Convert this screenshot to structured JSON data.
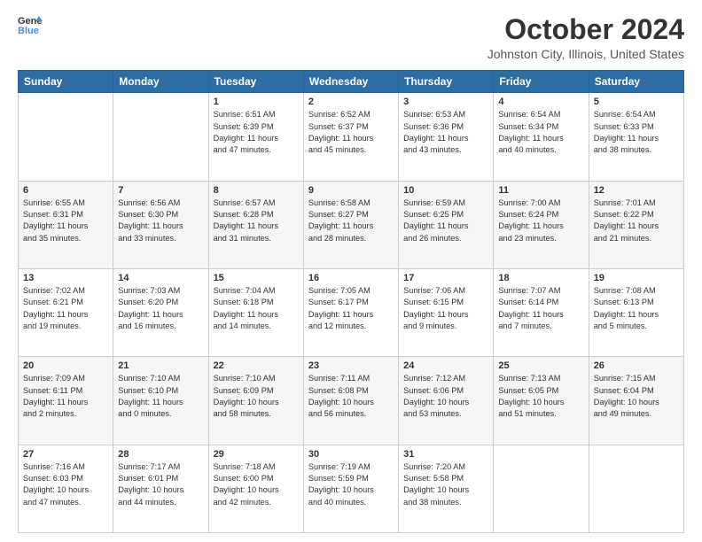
{
  "logo": {
    "line1": "General",
    "line2": "Blue",
    "icon_color": "#4a90d9"
  },
  "header": {
    "title": "October 2024",
    "subtitle": "Johnston City, Illinois, United States"
  },
  "weekdays": [
    "Sunday",
    "Monday",
    "Tuesday",
    "Wednesday",
    "Thursday",
    "Friday",
    "Saturday"
  ],
  "weeks": [
    [
      {
        "day": "",
        "info": ""
      },
      {
        "day": "",
        "info": ""
      },
      {
        "day": "1",
        "info": "Sunrise: 6:51 AM\nSunset: 6:39 PM\nDaylight: 11 hours\nand 47 minutes."
      },
      {
        "day": "2",
        "info": "Sunrise: 6:52 AM\nSunset: 6:37 PM\nDaylight: 11 hours\nand 45 minutes."
      },
      {
        "day": "3",
        "info": "Sunrise: 6:53 AM\nSunset: 6:36 PM\nDaylight: 11 hours\nand 43 minutes."
      },
      {
        "day": "4",
        "info": "Sunrise: 6:54 AM\nSunset: 6:34 PM\nDaylight: 11 hours\nand 40 minutes."
      },
      {
        "day": "5",
        "info": "Sunrise: 6:54 AM\nSunset: 6:33 PM\nDaylight: 11 hours\nand 38 minutes."
      }
    ],
    [
      {
        "day": "6",
        "info": "Sunrise: 6:55 AM\nSunset: 6:31 PM\nDaylight: 11 hours\nand 35 minutes."
      },
      {
        "day": "7",
        "info": "Sunrise: 6:56 AM\nSunset: 6:30 PM\nDaylight: 11 hours\nand 33 minutes."
      },
      {
        "day": "8",
        "info": "Sunrise: 6:57 AM\nSunset: 6:28 PM\nDaylight: 11 hours\nand 31 minutes."
      },
      {
        "day": "9",
        "info": "Sunrise: 6:58 AM\nSunset: 6:27 PM\nDaylight: 11 hours\nand 28 minutes."
      },
      {
        "day": "10",
        "info": "Sunrise: 6:59 AM\nSunset: 6:25 PM\nDaylight: 11 hours\nand 26 minutes."
      },
      {
        "day": "11",
        "info": "Sunrise: 7:00 AM\nSunset: 6:24 PM\nDaylight: 11 hours\nand 23 minutes."
      },
      {
        "day": "12",
        "info": "Sunrise: 7:01 AM\nSunset: 6:22 PM\nDaylight: 11 hours\nand 21 minutes."
      }
    ],
    [
      {
        "day": "13",
        "info": "Sunrise: 7:02 AM\nSunset: 6:21 PM\nDaylight: 11 hours\nand 19 minutes."
      },
      {
        "day": "14",
        "info": "Sunrise: 7:03 AM\nSunset: 6:20 PM\nDaylight: 11 hours\nand 16 minutes."
      },
      {
        "day": "15",
        "info": "Sunrise: 7:04 AM\nSunset: 6:18 PM\nDaylight: 11 hours\nand 14 minutes."
      },
      {
        "day": "16",
        "info": "Sunrise: 7:05 AM\nSunset: 6:17 PM\nDaylight: 11 hours\nand 12 minutes."
      },
      {
        "day": "17",
        "info": "Sunrise: 7:06 AM\nSunset: 6:15 PM\nDaylight: 11 hours\nand 9 minutes."
      },
      {
        "day": "18",
        "info": "Sunrise: 7:07 AM\nSunset: 6:14 PM\nDaylight: 11 hours\nand 7 minutes."
      },
      {
        "day": "19",
        "info": "Sunrise: 7:08 AM\nSunset: 6:13 PM\nDaylight: 11 hours\nand 5 minutes."
      }
    ],
    [
      {
        "day": "20",
        "info": "Sunrise: 7:09 AM\nSunset: 6:11 PM\nDaylight: 11 hours\nand 2 minutes."
      },
      {
        "day": "21",
        "info": "Sunrise: 7:10 AM\nSunset: 6:10 PM\nDaylight: 11 hours\nand 0 minutes."
      },
      {
        "day": "22",
        "info": "Sunrise: 7:10 AM\nSunset: 6:09 PM\nDaylight: 10 hours\nand 58 minutes."
      },
      {
        "day": "23",
        "info": "Sunrise: 7:11 AM\nSunset: 6:08 PM\nDaylight: 10 hours\nand 56 minutes."
      },
      {
        "day": "24",
        "info": "Sunrise: 7:12 AM\nSunset: 6:06 PM\nDaylight: 10 hours\nand 53 minutes."
      },
      {
        "day": "25",
        "info": "Sunrise: 7:13 AM\nSunset: 6:05 PM\nDaylight: 10 hours\nand 51 minutes."
      },
      {
        "day": "26",
        "info": "Sunrise: 7:15 AM\nSunset: 6:04 PM\nDaylight: 10 hours\nand 49 minutes."
      }
    ],
    [
      {
        "day": "27",
        "info": "Sunrise: 7:16 AM\nSunset: 6:03 PM\nDaylight: 10 hours\nand 47 minutes."
      },
      {
        "day": "28",
        "info": "Sunrise: 7:17 AM\nSunset: 6:01 PM\nDaylight: 10 hours\nand 44 minutes."
      },
      {
        "day": "29",
        "info": "Sunrise: 7:18 AM\nSunset: 6:00 PM\nDaylight: 10 hours\nand 42 minutes."
      },
      {
        "day": "30",
        "info": "Sunrise: 7:19 AM\nSunset: 5:59 PM\nDaylight: 10 hours\nand 40 minutes."
      },
      {
        "day": "31",
        "info": "Sunrise: 7:20 AM\nSunset: 5:58 PM\nDaylight: 10 hours\nand 38 minutes."
      },
      {
        "day": "",
        "info": ""
      },
      {
        "day": "",
        "info": ""
      }
    ]
  ]
}
